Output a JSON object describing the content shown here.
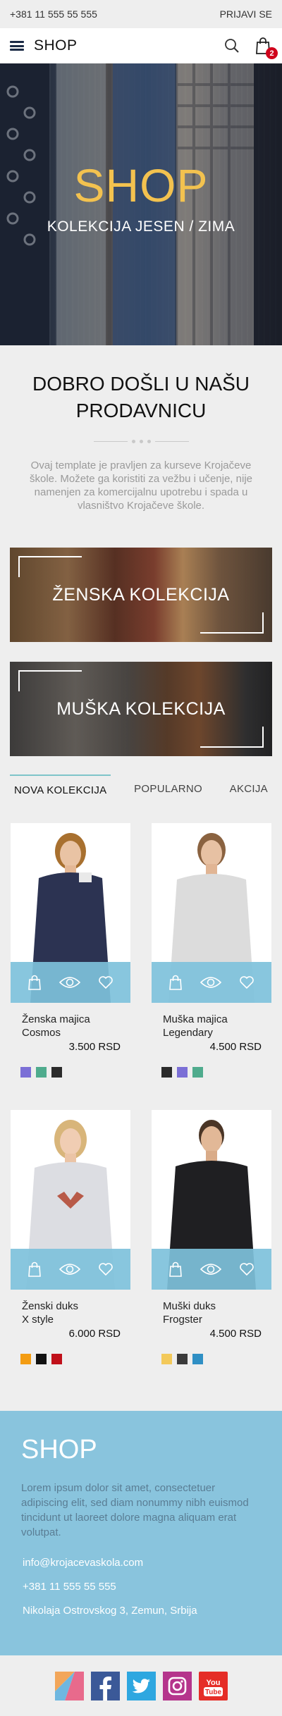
{
  "topbar": {
    "phone": "+381 11 555 55 555",
    "login": "PRIJAVI SE"
  },
  "navbar": {
    "brand": "SHOP",
    "cart_count": "2"
  },
  "hero": {
    "title": "SHOP",
    "subtitle": "KOLEKCIJA JESEN / ZIMA"
  },
  "welcome": {
    "title": "DOBRO DOŠLI U NAŠU PRODAVNICU",
    "text": "Ovaj template je pravljen za kurseve Krojačeve škole. Možete ga koristiti za vežbu i učenje, nije namenjen za komercijalnu upotrebu i spada u vlasništvo Krojačeve škole."
  },
  "collections": {
    "women": "ŽENSKA KOLEKCIJA",
    "men": "MUŠKA KOLEKCIJA"
  },
  "tabs": [
    "NOVA KOLEKCIJA",
    "POPULARNO",
    "AKCIJA"
  ],
  "products": [
    {
      "name": "Ženska majica\nCosmos",
      "price": "3.500 RSD",
      "colors": [
        "#7b6fd6",
        "#4fab8d",
        "#2b2b2b"
      ]
    },
    {
      "name": "Muška majica\nLegendary",
      "price": "4.500 RSD",
      "colors": [
        "#2b2b2b",
        "#7b6fd6",
        "#4fab8d"
      ]
    },
    {
      "name": "Ženski duks\nX style",
      "price": "6.000 RSD",
      "colors": [
        "#f39c12",
        "#111111",
        "#c0101a"
      ]
    },
    {
      "name": "Muški duks\nFrogster",
      "price": "4.500 RSD",
      "colors": [
        "#f3c95a",
        "#3a3a3a",
        "#2f8fc4"
      ]
    }
  ],
  "footer": {
    "brand": "SHOP",
    "text": "Lorem ipsum dolor sit amet, consectetuer adipiscing elit, sed diam nonummy nibh euismod tincidunt ut laoreet dolore magna aliquam erat volutpat.",
    "email": "info@krojacevaskola.com",
    "phone": "+381 11 555 55 555",
    "address": "Nikolaja Ostrovskog 3, Zemun, Srbija"
  },
  "social": [
    "kontakt-icon",
    "facebook-icon",
    "twitter-icon",
    "instagram-icon",
    "youtube-icon"
  ],
  "social_youtube_label": "You\nTube",
  "colors": {
    "accent": "#f3c24f",
    "footer_bg": "#89c4dd",
    "action_bar": "#7ec1db",
    "tab_active": "#7ec5c9",
    "badge": "#d0021b"
  }
}
